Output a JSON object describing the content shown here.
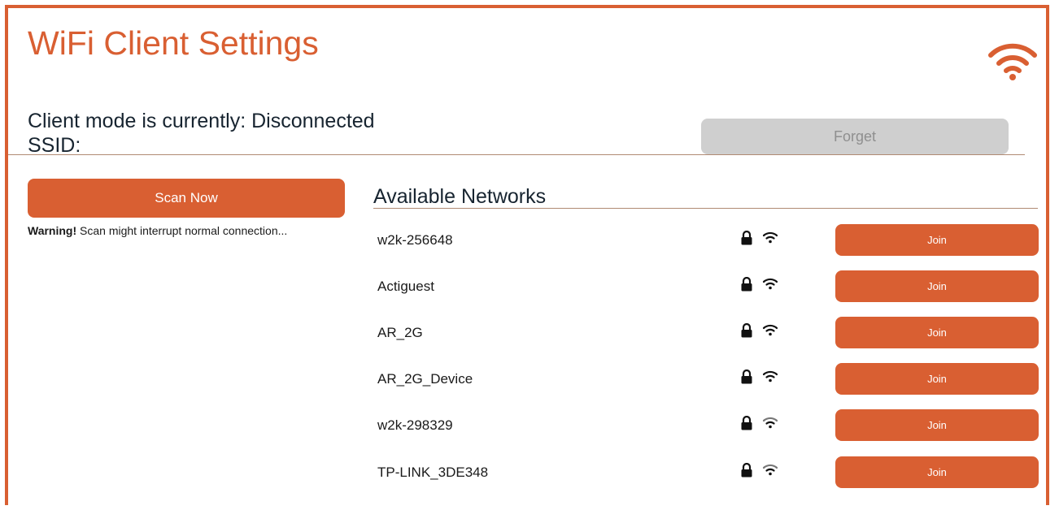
{
  "header": {
    "title": "WiFi Client Settings",
    "status_line": "Client mode is currently: Disconnected",
    "ssid_line": "SSID:"
  },
  "actions": {
    "forget_label": "Forget",
    "scan_label": "Scan Now",
    "warning_strong": "Warning!",
    "warning_text": " Scan might interrupt normal connection..."
  },
  "networks": {
    "heading": "Available Networks",
    "items": [
      {
        "ssid": "w2k-256648",
        "join_label": "Join"
      },
      {
        "ssid": "Actiguest",
        "join_label": "Join"
      },
      {
        "ssid": "AR_2G",
        "join_label": "Join"
      },
      {
        "ssid": "AR_2G_Device",
        "join_label": "Join"
      },
      {
        "ssid": "w2k-298329",
        "join_label": "Join"
      },
      {
        "ssid": "TP-LINK_3DE348",
        "join_label": "Join"
      }
    ]
  },
  "icons": {
    "logo": "wifi-icon",
    "secured": "lock-icon",
    "signal": "wifi-signal-icon"
  },
  "colors": {
    "accent": "#d95f32",
    "disabled_button": "#cfcfcf",
    "heading_text": "#172430"
  }
}
